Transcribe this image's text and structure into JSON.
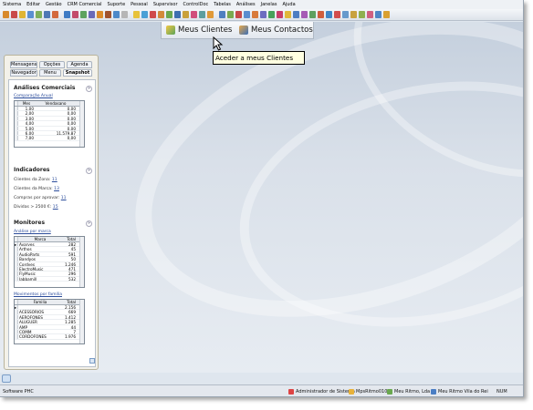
{
  "menubar": {
    "items": [
      "Sistema",
      "Editar",
      "Gestão",
      "CRM Comercial",
      "Suporte",
      "Pessoal",
      "Supervisor",
      "ControlDoc",
      "Tabelas",
      "Análises",
      "Janelas",
      "Ajuda"
    ]
  },
  "quickbar": {
    "clientes_label": "Meus Clientes",
    "contactos_label": "Meus Contactos",
    "tooltip": "Aceder a meus Clientes"
  },
  "panel": {
    "tabs_row1": [
      "Mensagens",
      "Opções",
      "Agenda"
    ],
    "tabs_row2": [
      "Navegador",
      "Menu",
      "Snapshot"
    ],
    "analises": {
      "title": "Análises Comerciais",
      "link": "Comparação Anual",
      "col_mes": "Mes",
      "col_vendas": "Vendasano",
      "rows": [
        {
          "mes": "1,00",
          "val": "0,00"
        },
        {
          "mes": "2,00",
          "val": "0,00"
        },
        {
          "mes": "3,00",
          "val": "0,00"
        },
        {
          "mes": "4,00",
          "val": "0,00"
        },
        {
          "mes": "5,00",
          "val": "0,00"
        },
        {
          "mes": "6,00",
          "val": "11.579,87"
        },
        {
          "mes": "7,00",
          "val": "0,00"
        }
      ]
    },
    "indicadores": {
      "title": "Indicadores",
      "items": [
        {
          "label": "Clientes da Zona:",
          "value": "11"
        },
        {
          "label": "Clientes da Marca:",
          "value": "13"
        },
        {
          "label": "Compras por aprovar:",
          "value": "11"
        },
        {
          "label": "Dívidas > 2500 €:",
          "value": "15"
        }
      ]
    },
    "monitores": {
      "title": "Monitores",
      "link1": "Análise por marca",
      "col_marca": "Marca",
      "col_total": "Total",
      "marcas": [
        {
          "n": "Avaryes",
          "v": "282"
        },
        {
          "n": "Arthos",
          "v": "45"
        },
        {
          "n": "AudioParts",
          "v": "591"
        },
        {
          "n": "Bandyos",
          "v": "50"
        },
        {
          "n": "Cordyes",
          "v": "1.246"
        },
        {
          "n": "ElectroMusic",
          "v": "471"
        },
        {
          "n": "FlyMusic",
          "v": "296"
        },
        {
          "n": "Jabbamill",
          "v": "532"
        }
      ],
      "link2": "Movimentos por família",
      "col_familia": "Familia",
      "col_total2": "Total",
      "familias": [
        {
          "n": "",
          "v": "2.156"
        },
        {
          "n": "ACESSÓRIOS",
          "v": "669"
        },
        {
          "n": "AEROFONES",
          "v": "1.412"
        },
        {
          "n": "ALUGUER",
          "v": "1.285"
        },
        {
          "n": "AMP",
          "v": "44"
        },
        {
          "n": "COMM",
          "v": "7"
        },
        {
          "n": "CORDOFONES",
          "v": "1.976"
        }
      ]
    }
  },
  "statusbar": {
    "app": "Software PHC",
    "user": "Administrador de Sistema",
    "db": "MpsRitmo010",
    "company": "Meu Ritmo, Lda",
    "store": "Meu Ritmo Vila do Rei",
    "num": "NUM"
  },
  "colors": {
    "accent": "#2b4c9b",
    "tooltip_bg": "#ffffe1"
  }
}
